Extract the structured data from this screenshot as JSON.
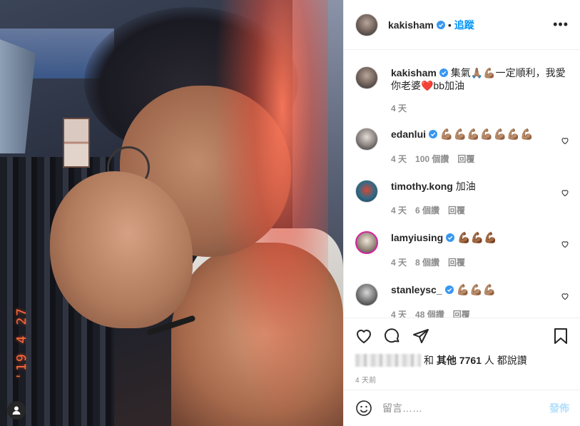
{
  "photo": {
    "date_stamp": "'19 4 27"
  },
  "header": {
    "username": "kakisham",
    "follow_label": "追蹤",
    "more_label": "•••"
  },
  "caption": {
    "username": "kakisham",
    "text": "集氣🙏🏽💪🏽一定順利，我愛你老婆❤️bb加油",
    "time": "4 天"
  },
  "comments": [
    {
      "username": "edanlui",
      "verified": true,
      "text": "💪🏽💪🏽💪🏽💪🏽💪🏽💪🏽💪🏽",
      "time": "4 天",
      "likes": "100 個讚",
      "reply": "回覆"
    },
    {
      "username": "timothy.kong",
      "verified": false,
      "text": "加油",
      "time": "4 天",
      "likes": "6 個讚",
      "reply": "回覆"
    },
    {
      "username": "lamyiusing",
      "verified": true,
      "text": "💪🏾💪🏾💪🏾",
      "time": "4 天",
      "likes": "8 個讚",
      "reply": "回覆"
    },
    {
      "username": "stanleysc_",
      "verified": true,
      "text": "💪🏽💪🏽💪🏽",
      "time": "4 天",
      "likes": "48 個讚",
      "reply": "回覆"
    }
  ],
  "likes": {
    "prefix": "和",
    "others": "其他",
    "count": "7761",
    "suffix": "人 都說讚"
  },
  "post_time": "4 天前",
  "add_comment": {
    "placeholder": "留言……",
    "post_label": "發佈"
  },
  "colors": {
    "accent": "#0095f6",
    "verified": "#3897f0",
    "text": "#262626",
    "muted": "#8e8e8e",
    "post_disabled": "#b2dffc"
  }
}
